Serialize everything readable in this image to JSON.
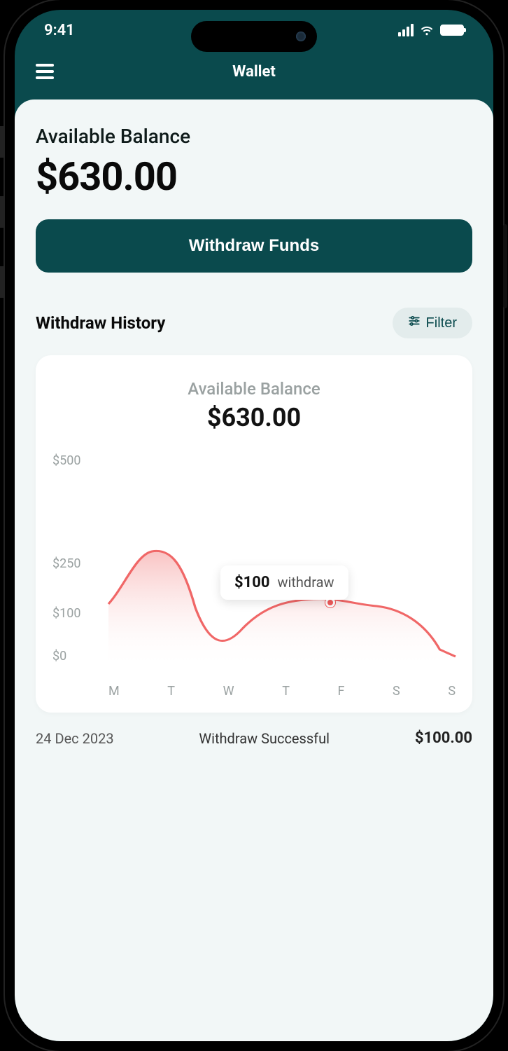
{
  "status_bar": {
    "time": "9:41"
  },
  "header": {
    "title": "Wallet"
  },
  "balance": {
    "label": "Available Balance",
    "amount": "$630.00"
  },
  "actions": {
    "withdraw_label": "Withdraw Funds"
  },
  "history": {
    "title": "Withdraw History",
    "filter_label": "Filter"
  },
  "chart": {
    "subtitle": "Available Balance",
    "amount": "$630.00",
    "tooltip_value": "$100",
    "tooltip_label": "withdraw"
  },
  "chart_data": {
    "type": "area",
    "title": "Available Balance",
    "ylabel": "",
    "xlabel": "",
    "ylim": [
      0,
      500
    ],
    "y_ticks": [
      "$500",
      "$250",
      "$100",
      "$0"
    ],
    "categories": [
      "M",
      "T",
      "W",
      "T",
      "F",
      "S",
      "S"
    ],
    "values": [
      120,
      200,
      40,
      95,
      110,
      105,
      30
    ],
    "highlight": {
      "category": "F",
      "value": 100,
      "label": "$100 withdraw"
    },
    "colors": {
      "line": "#f06767",
      "fill_top": "#fbd1d1",
      "fill_bottom": "#ffffff"
    }
  },
  "transactions": [
    {
      "date": "24 Dec 2023",
      "status": "Withdraw Successful",
      "amount": "$100.00"
    }
  ]
}
